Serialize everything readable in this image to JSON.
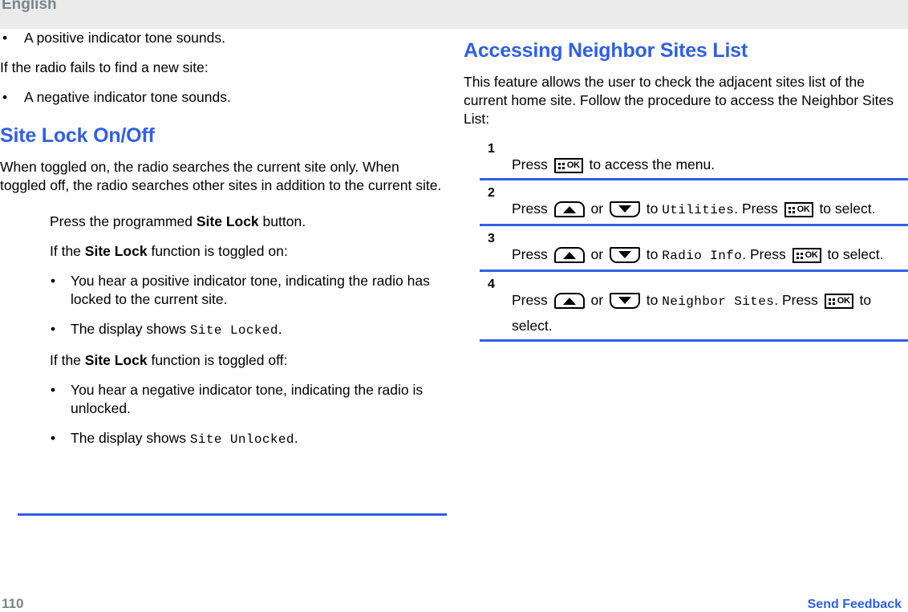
{
  "header": {
    "language_label": "English"
  },
  "footer": {
    "page_number": "110",
    "send_feedback_label": "Send Feedback"
  },
  "colors": {
    "heading_blue": "#2f5fe8",
    "rule_blue": "#2f5fe8",
    "header_band": "#ebebeb",
    "header_text": "#78868a",
    "body_text": "#000000"
  },
  "icons": {
    "ok_key": "ok-menu-key-icon",
    "up_key": "up-arrow-key-icon",
    "down_key": "down-arrow-key-icon",
    "ok_key_label": "OK"
  },
  "left_column": {
    "carryover_bullet_1": "A positive indicator tone sounds.",
    "carryover_para": "If the radio fails to find a new site:",
    "carryover_bullet_2": "A negative indicator tone sounds.",
    "section": {
      "heading": "Site Lock On/Off",
      "intro": "When toggled on, the radio searches the current site only. When toggled off, the radio searches other sites in addition to the current site.",
      "steps": {
        "press_button_prefix": "Press the programmed ",
        "press_button_bold": "Site Lock",
        "press_button_suffix": " button.",
        "toggled_on_prefix": "If the ",
        "toggled_on_bold": "Site Lock",
        "toggled_on_suffix": " function is toggled on:",
        "on_bullet_1": "You hear a positive indicator tone, indicating the radio has locked to the current site.",
        "on_bullet_2_prefix": "The display shows ",
        "on_bullet_2_mono": "Site Locked",
        "on_bullet_2_suffix": ".",
        "toggled_off_prefix": "If the ",
        "toggled_off_bold": "Site Lock",
        "toggled_off_suffix": " function is toggled off:",
        "off_bullet_1": "You hear a negative indicator tone, indicating the radio is unlocked.",
        "off_bullet_2_prefix": "The display shows ",
        "off_bullet_2_mono": "Site Unlocked",
        "off_bullet_2_suffix": "."
      }
    },
    "bullet_mark": "•"
  },
  "right_column": {
    "heading": "Accessing Neighbor Sites List",
    "intro": "This feature allows the user to check the adjacent sites list of the current home site. Follow the procedure to access the Neighbor Sites List:",
    "procedure": [
      {
        "number": "1",
        "seg_1": "Press ",
        "seg_2": " to access the menu."
      },
      {
        "number": "2",
        "seg_1": "Press ",
        "seg_2": " or ",
        "seg_3": " to ",
        "mono_term": "Utilities",
        "seg_4": ". Press ",
        "seg_5": " to select."
      },
      {
        "number": "3",
        "seg_1": "Press ",
        "seg_2": " or ",
        "seg_3": " to ",
        "mono_term": "Radio Info",
        "seg_4": ". Press ",
        "seg_5": " to select."
      },
      {
        "number": "4",
        "seg_1": "Press ",
        "seg_2": " or ",
        "seg_3": " to ",
        "mono_term": "Neighbor Sites",
        "seg_4": ". Press ",
        "seg_5": " to select."
      }
    ]
  }
}
